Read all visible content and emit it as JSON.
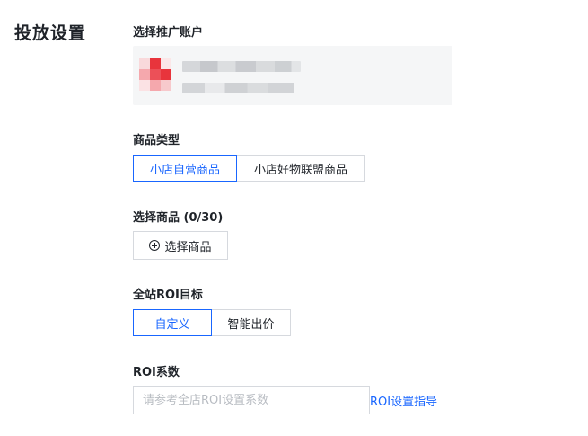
{
  "page": {
    "title": "投放设置"
  },
  "account": {
    "label": "选择推广账户",
    "avatar_colors": [
      "#e8343c",
      "#f5a8ad",
      "#f7c9cc"
    ]
  },
  "product_type": {
    "label": "商品类型",
    "options": [
      "小店自营商品",
      "小店好物联盟商品"
    ],
    "selected": "小店自营商品"
  },
  "select_product": {
    "label": "选择商品 (0/30)",
    "button_label": "选择商品"
  },
  "roi_target": {
    "label": "全站ROI目标",
    "options": [
      "自定义",
      "智能出价"
    ],
    "selected": "自定义"
  },
  "roi_coef": {
    "label": "ROI系数",
    "placeholder": "请参考全店ROI设置系数",
    "guide_link": "ROI设置指导"
  },
  "colors": {
    "accent": "#1966ff",
    "border": "#d6d9de",
    "card_bg": "#f5f6f7"
  }
}
